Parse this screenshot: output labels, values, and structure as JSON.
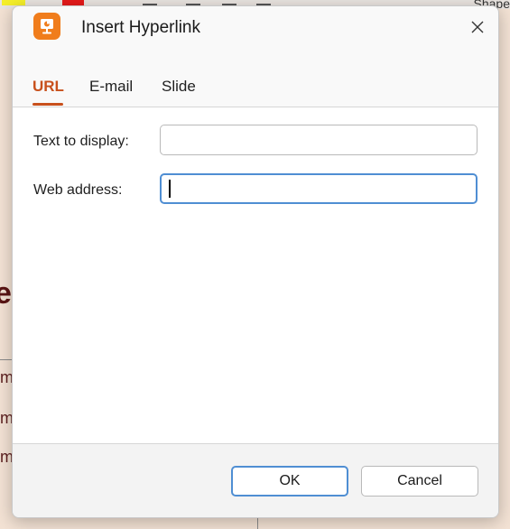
{
  "dialog": {
    "title": "Insert Hyperlink",
    "app_icon": "presentation-app-icon",
    "close_icon": "close-icon",
    "accent_color": "#c8501c",
    "focus_color": "#4f8ed3"
  },
  "tabs": [
    {
      "label": "URL",
      "active": true
    },
    {
      "label": "E-mail",
      "active": false
    },
    {
      "label": "Slide",
      "active": false
    }
  ],
  "form": {
    "text_to_display_label": "Text to display:",
    "text_to_display_value": "",
    "web_address_label": "Web address:",
    "web_address_value": ""
  },
  "buttons": {
    "ok": "OK",
    "cancel": "Cancel"
  },
  "background": {
    "shape_label": "Shape",
    "large_text_fragment": "e",
    "text_fragments": [
      "m",
      "m",
      "m"
    ]
  }
}
